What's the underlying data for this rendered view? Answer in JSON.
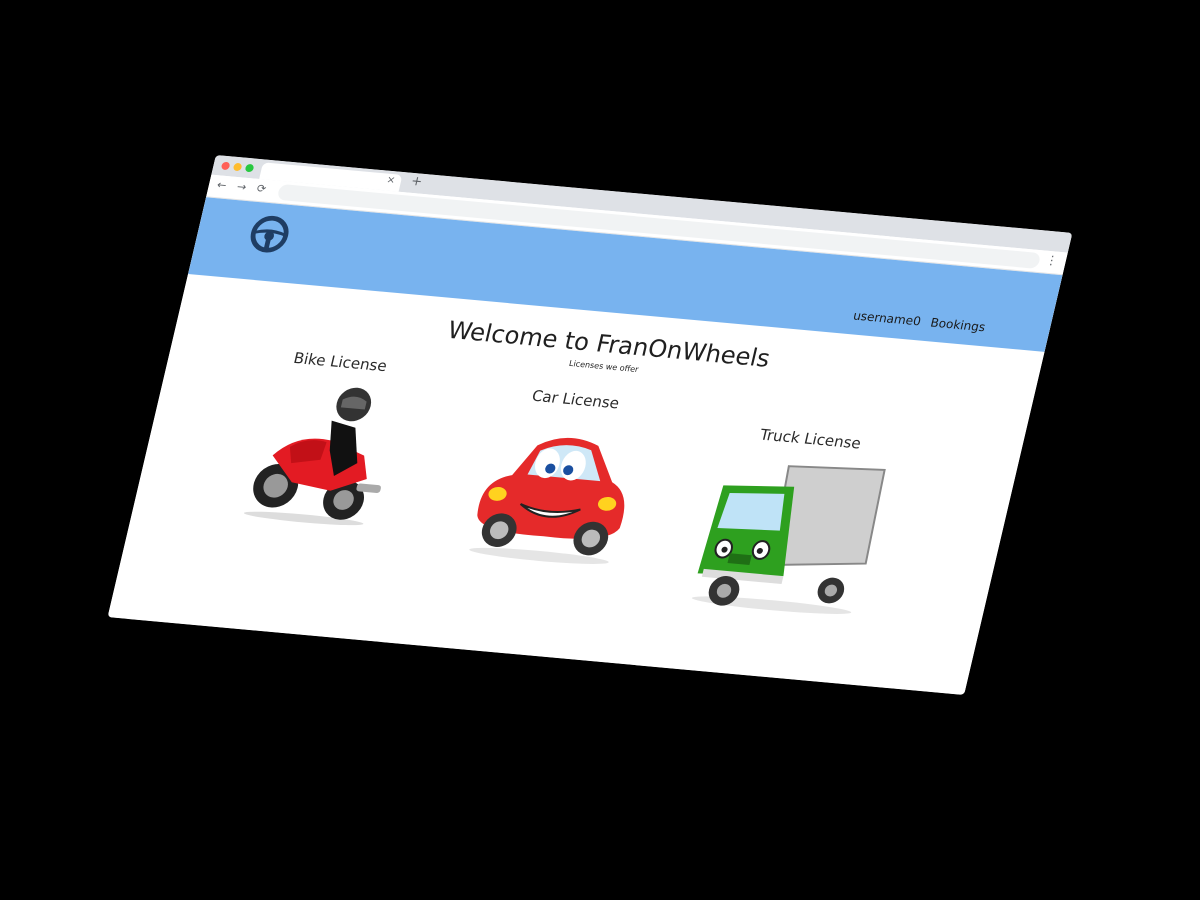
{
  "browser": {
    "tab_close": "×",
    "new_tab": "+",
    "back": "←",
    "forward": "→",
    "reload": "⟳",
    "menu": "⋮",
    "traffic_lights": [
      "#ff5f57",
      "#febc2e",
      "#28c840"
    ]
  },
  "navbar": {
    "logo_icon": "steering-wheel-icon",
    "links": [
      "username0",
      "Bookings"
    ],
    "background": "#78b3ef"
  },
  "hero": {
    "title": "Welcome to FranOnWheels",
    "subtitle": "Licenses we offer"
  },
  "licenses": [
    {
      "title": "Bike License",
      "image": "motorbike-cartoon"
    },
    {
      "title": "Car License",
      "image": "car-cartoon"
    },
    {
      "title": "Truck License",
      "image": "truck-cartoon"
    }
  ]
}
